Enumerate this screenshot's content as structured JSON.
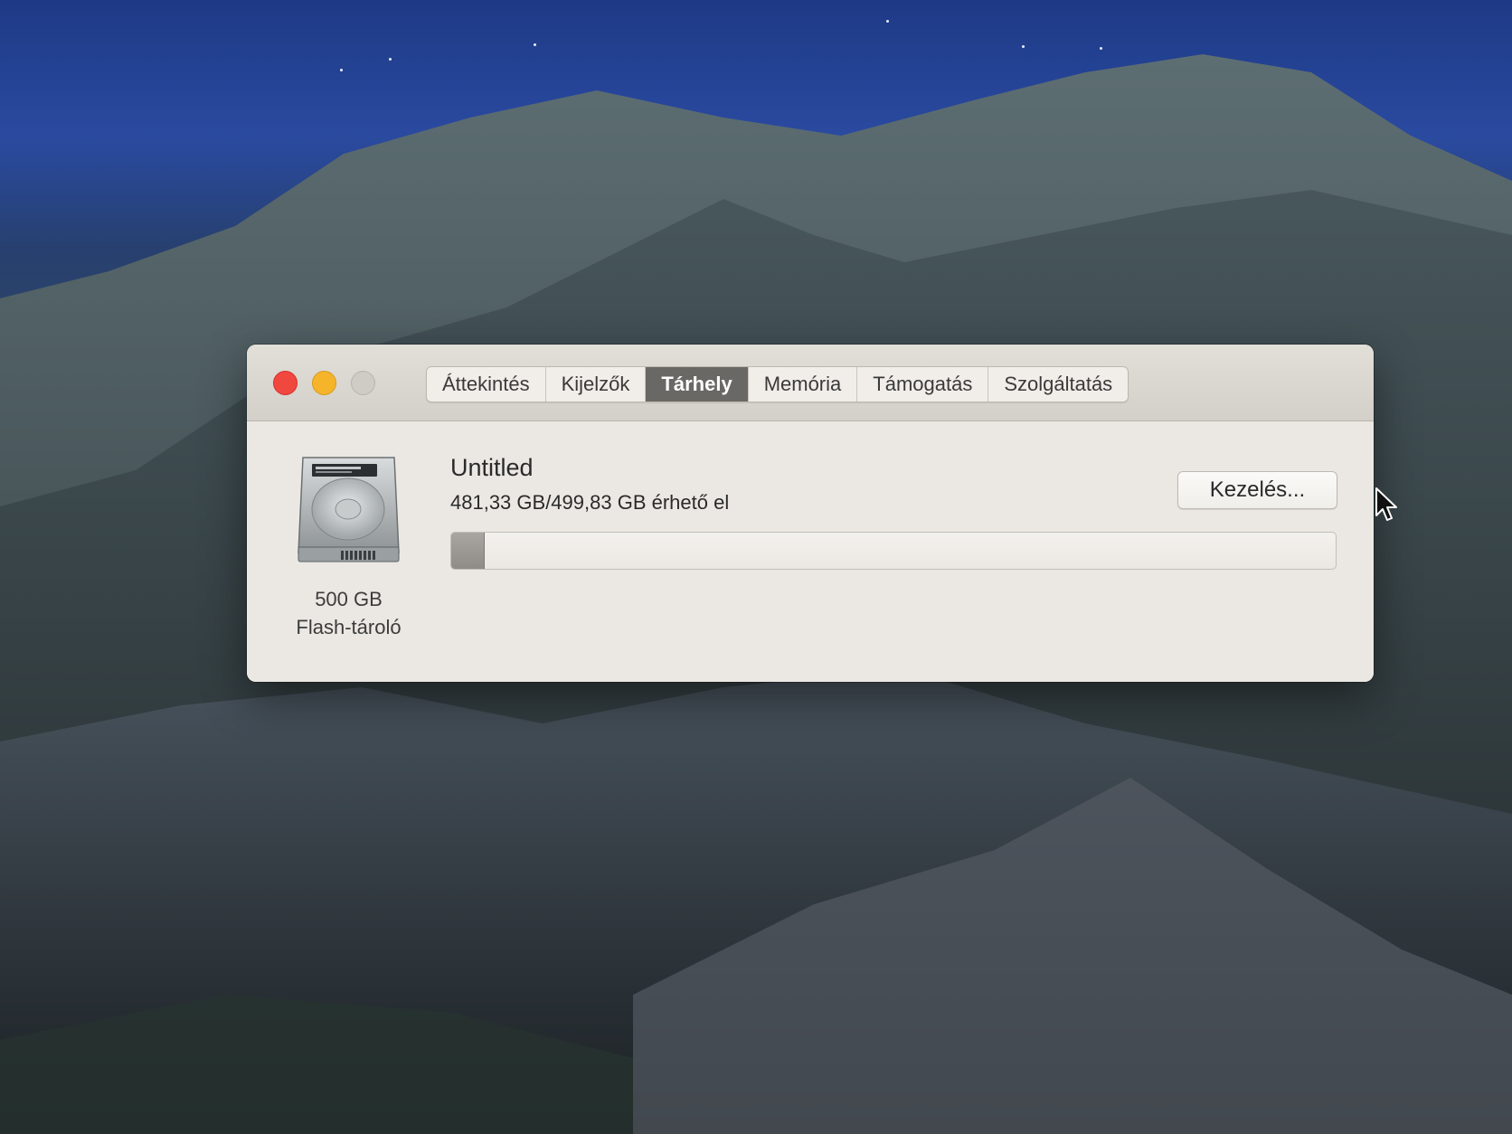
{
  "window": {
    "traffic_lights": [
      "close",
      "minimize",
      "zoom"
    ],
    "tabs": [
      {
        "label": "Áttekintés",
        "active": false
      },
      {
        "label": "Kijelzők",
        "active": false
      },
      {
        "label": "Tárhely",
        "active": true
      },
      {
        "label": "Memória",
        "active": false
      },
      {
        "label": "Támogatás",
        "active": false
      },
      {
        "label": "Szolgáltatás",
        "active": false
      }
    ]
  },
  "storage": {
    "disk_icon": "hard-drive-icon",
    "disk_size": "500 GB",
    "disk_type": "Flash-tároló",
    "volume_name": "Untitled",
    "available_text": "481,33 GB/499,83 GB érhető el",
    "manage_label": "Kezelés...",
    "used_fraction": 0.037
  },
  "colors": {
    "close": "#f0473f",
    "minimize": "#f5b42a",
    "zoom_inactive": "#cfcbc5",
    "active_tab": "#6a6864"
  }
}
